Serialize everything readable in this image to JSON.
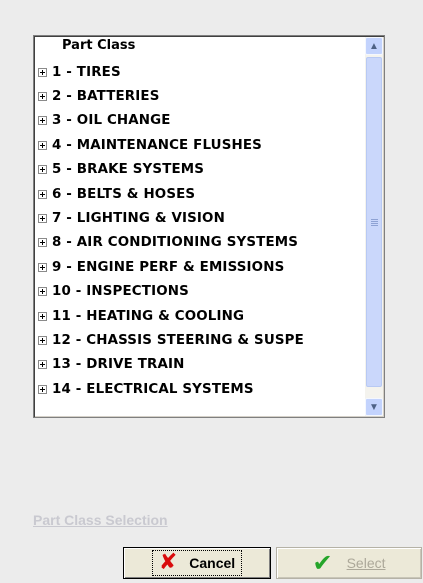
{
  "tree": {
    "root_label": "Part Class",
    "items": [
      {
        "label": "1 - TIRES"
      },
      {
        "label": "2 - BATTERIES"
      },
      {
        "label": "3 - OIL CHANGE"
      },
      {
        "label": "4 - MAINTENANCE FLUSHES"
      },
      {
        "label": "5 - BRAKE SYSTEMS"
      },
      {
        "label": "6 - BELTS & HOSES"
      },
      {
        "label": "7 - LIGHTING & VISION"
      },
      {
        "label": "8 - AIR CONDITIONING SYSTEMS"
      },
      {
        "label": "9 - ENGINE PERF & EMISSIONS"
      },
      {
        "label": "10 - INSPECTIONS"
      },
      {
        "label": "11 - HEATING & COOLING"
      },
      {
        "label": "12 - CHASSIS STEERING & SUSPE"
      },
      {
        "label": "13 - DRIVE TRAIN"
      },
      {
        "label": "14 - ELECTRICAL SYSTEMS"
      }
    ]
  },
  "caption": "Part Class Selection",
  "buttons": {
    "cancel": {
      "label": "Cancel",
      "icon": "x-icon",
      "color": "#d90c0c"
    },
    "select": {
      "label": "Select",
      "icon": "check-icon",
      "color": "#25a52a",
      "enabled": false
    }
  },
  "scrollbar": {
    "position": 0.0
  }
}
